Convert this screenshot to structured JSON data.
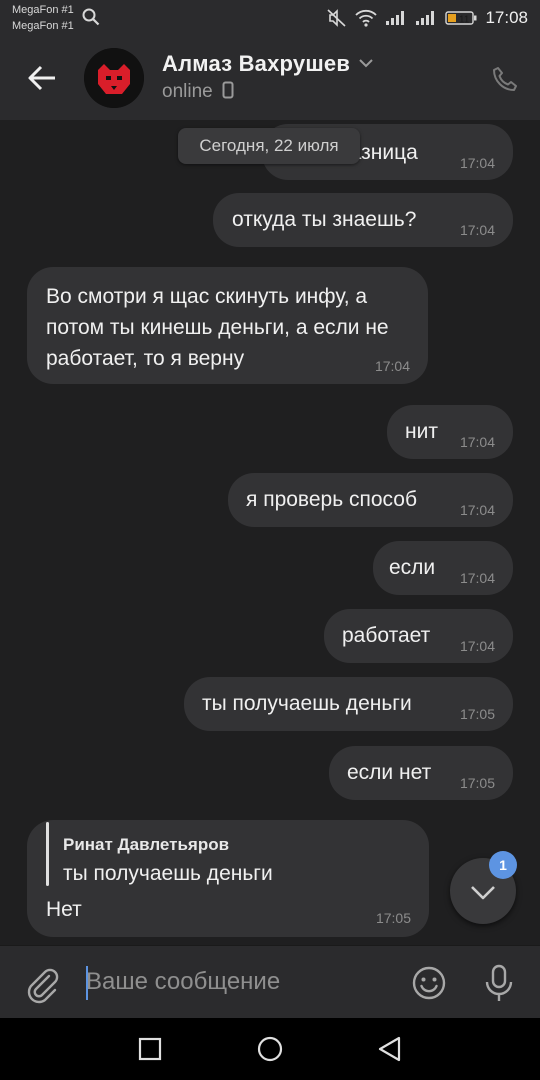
{
  "status_bar": {
    "carrier1": "MegaFon #1",
    "carrier2": "MegaFon #1",
    "battery": "11",
    "time": "17:08"
  },
  "header": {
    "name": "Алмаз Вахрушев",
    "status": "online"
  },
  "date_chip": "Сегодня, 22 июля",
  "messages": [
    {
      "text": "разница",
      "time": "17:04",
      "side": "out"
    },
    {
      "text": "откуда ты знаешь?",
      "time": "17:04",
      "side": "out"
    },
    {
      "text": "Во смотри я щас скинуть инфу, а потом ты кинешь деньги, а если не работает, то я верну",
      "time": "17:04",
      "side": "in"
    },
    {
      "text": "нит",
      "time": "17:04",
      "side": "out"
    },
    {
      "text": "я проверь способ",
      "time": "17:04",
      "side": "out"
    },
    {
      "text": "если",
      "time": "17:04",
      "side": "out"
    },
    {
      "text": "работает",
      "time": "17:04",
      "side": "out"
    },
    {
      "text": "ты получаешь деньги",
      "time": "17:05",
      "side": "out"
    },
    {
      "text": "если нет",
      "time": "17:05",
      "side": "out"
    },
    {
      "reply_author": "Ринат Давлетьяров",
      "reply_text": "ты получаешь деньги",
      "text": "Нет",
      "time": "17:05",
      "side": "in"
    }
  ],
  "unread_badge": "1",
  "composer": {
    "placeholder": "Ваше сообщение"
  },
  "colors": {
    "background": "#1f1f20",
    "bar": "#2b2b2d",
    "bubble": "#333335",
    "accent": "#5d94e2"
  }
}
